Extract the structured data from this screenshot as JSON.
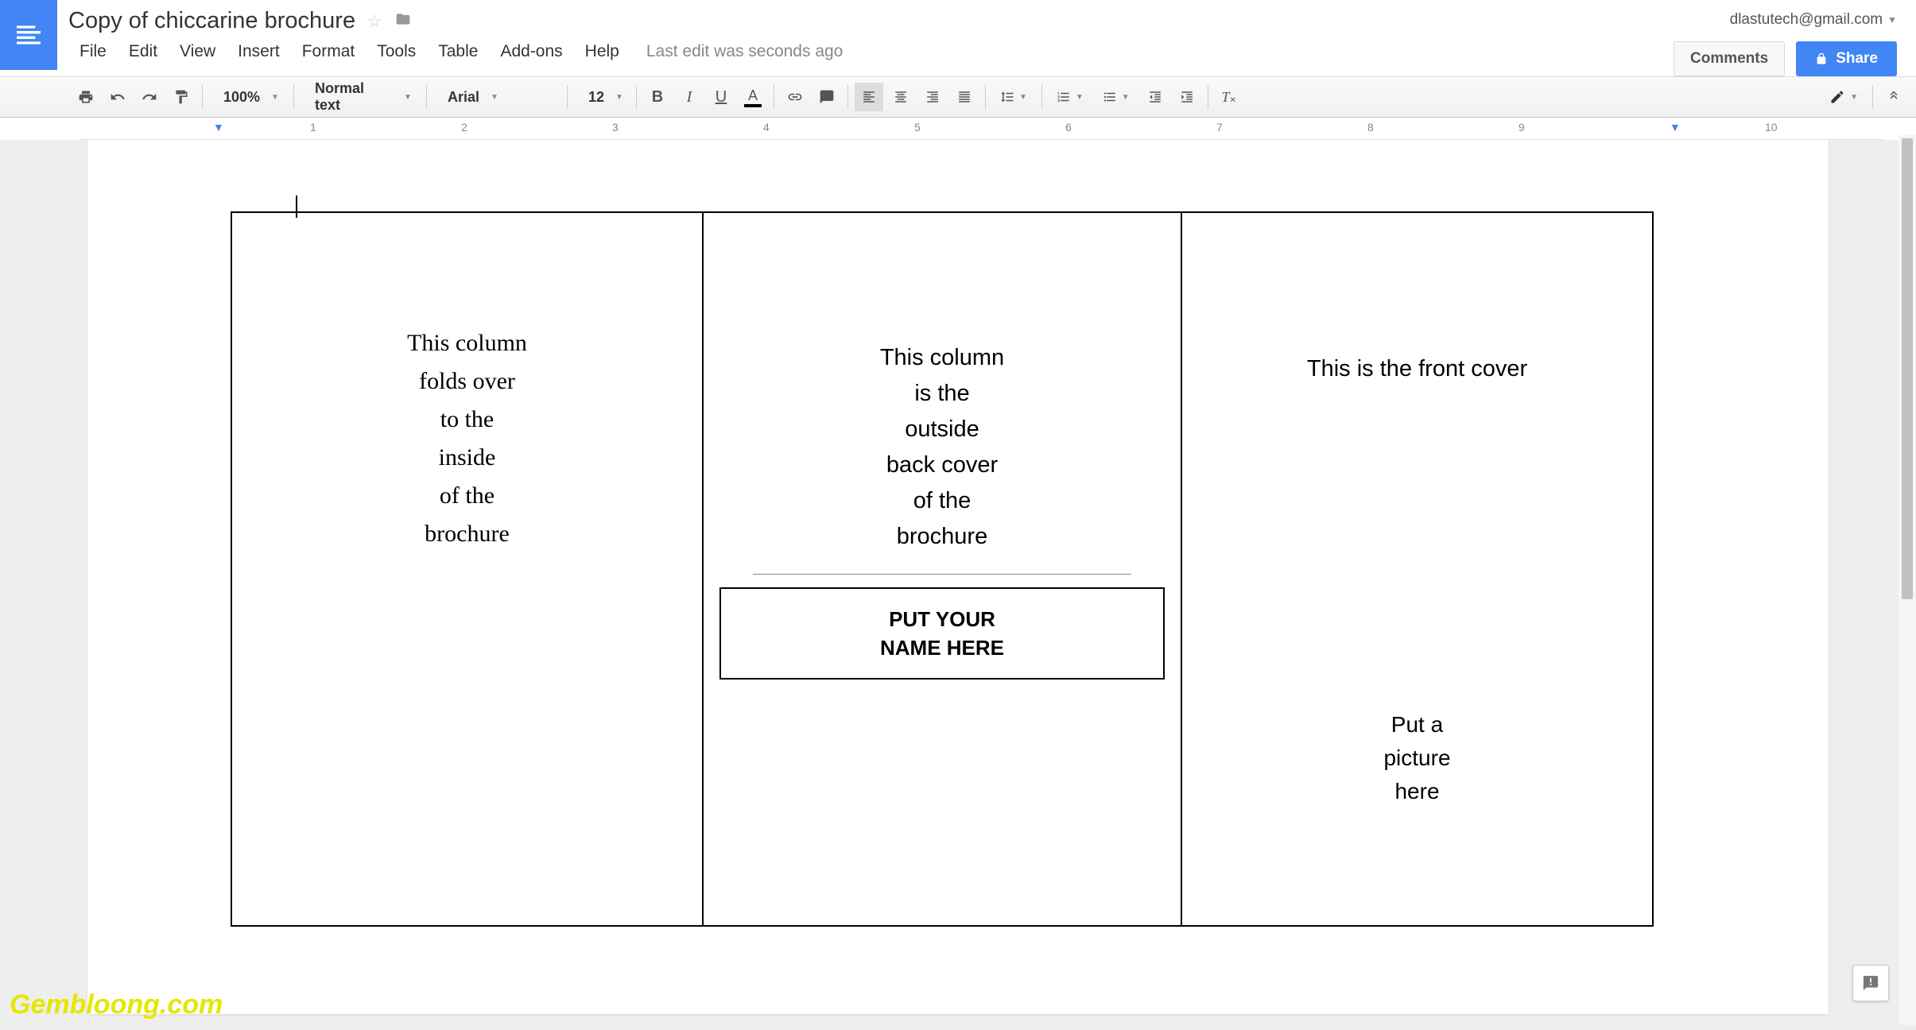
{
  "doc": {
    "title": "Copy of chiccarine brochure",
    "last_edit": "Last edit was seconds ago"
  },
  "account": {
    "email": "dlastutech@gmail.com"
  },
  "buttons": {
    "comments": "Comments",
    "share": "Share"
  },
  "menu": {
    "file": "File",
    "edit": "Edit",
    "view": "View",
    "insert": "Insert",
    "format": "Format",
    "tools": "Tools",
    "table": "Table",
    "addons": "Add-ons",
    "help": "Help"
  },
  "toolbar": {
    "zoom": "100%",
    "style": "Normal text",
    "font": "Arial",
    "size": "12"
  },
  "ruler": {
    "marks": [
      "1",
      "2",
      "3",
      "4",
      "5",
      "6",
      "7",
      "8",
      "9",
      "10"
    ]
  },
  "brochure": {
    "col1": "This column\nfolds over\nto the\ninside\nof the\nbrochure",
    "col2_text": "This column\nis the\noutside\nback cover\nof the\nbrochure",
    "col2_namebox": "PUT YOUR\nNAME HERE",
    "col3_front": "This is the front cover",
    "col3_picture": "Put a\npicture\nhere"
  },
  "watermark": "Gembloong.com"
}
